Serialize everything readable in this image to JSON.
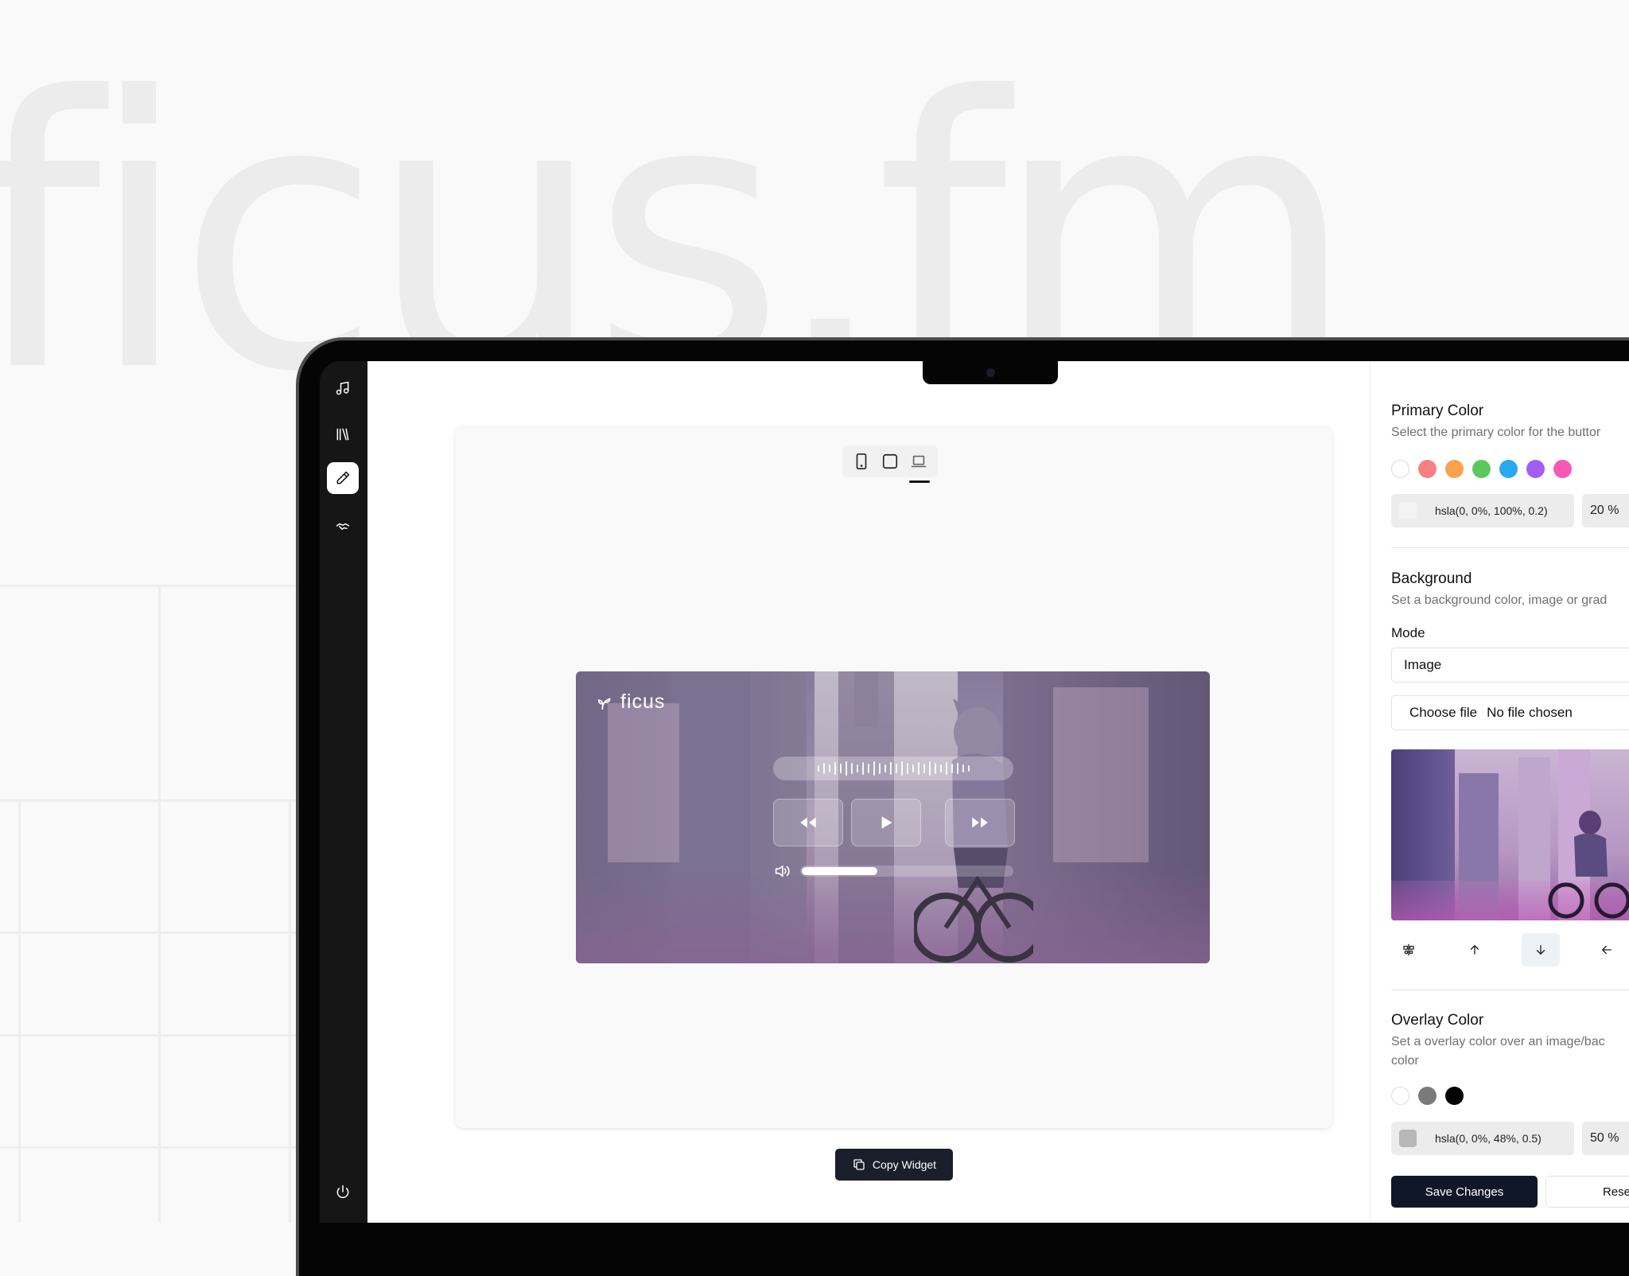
{
  "background": {
    "wordmark": "ficus.fm"
  },
  "sidebar": {
    "items": [
      {
        "icon": "music-note-icon"
      },
      {
        "icon": "library-icon"
      },
      {
        "icon": "pencil-icon",
        "active": true
      },
      {
        "icon": "handshake-icon"
      }
    ],
    "bottom_icon": "power-icon"
  },
  "preview": {
    "device_options": [
      "mobile",
      "tablet",
      "laptop"
    ],
    "selected_device": "laptop",
    "widget": {
      "brand": "ficus",
      "volume_fraction": 0.36
    },
    "copy_label": "Copy Widget"
  },
  "panel": {
    "primary_color": {
      "title": "Primary Color",
      "description": "Select the primary color for the buttor",
      "swatches": [
        "#ffffff",
        "#f88080",
        "#fca24f",
        "#5bc85b",
        "#2aa8f0",
        "#a45df2",
        "#f45ab4"
      ],
      "value": "hsla(0, 0%, 100%, 0.2)",
      "opacity": "20 %"
    },
    "background": {
      "title": "Background",
      "description": "Set a background color, image or grad",
      "mode_label": "Mode",
      "mode_value": "Image",
      "file_button": "Choose file",
      "file_status": "No file chosen"
    },
    "overlay_color": {
      "title": "Overlay Color",
      "description_line1": "Set a overlay color over an image/bac",
      "description_line2": "color",
      "swatches": [
        "#ffffff",
        "#7a7a7a",
        "#000000"
      ],
      "value": "hsla(0, 0%, 48%, 0.5)",
      "opacity": "50 %"
    },
    "save_label": "Save Changes",
    "reset_label": "Rese"
  }
}
